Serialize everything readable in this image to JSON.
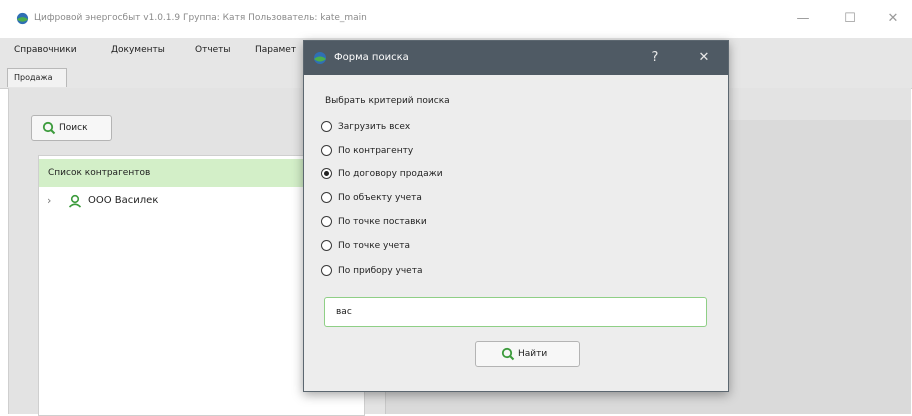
{
  "window": {
    "title": "Цифровой энергосбыт v1.0.1.9 Группа: Катя Пользователь: kate_main",
    "controls": {
      "minimize": "—",
      "maximize": "☐",
      "close": "✕"
    }
  },
  "menubar": {
    "items": [
      "Справочники",
      "Документы",
      "Отчеты",
      "Парамет"
    ]
  },
  "tabs": [
    {
      "label": "Продажа",
      "active": true
    }
  ],
  "left": {
    "search_button": "Поиск",
    "list_header": "Список контрагентов",
    "tree": [
      {
        "expander": "›",
        "icon": "person-icon",
        "label": "ООО Василек"
      }
    ]
  },
  "dialog": {
    "title": "Форма поиска",
    "help": "?",
    "close": "✕",
    "criteria_label": "Выбрать критерий поиска",
    "options": [
      {
        "label": "Загрузить всех",
        "checked": false
      },
      {
        "label": "По контрагенту",
        "checked": false
      },
      {
        "label": "По договору продажи",
        "checked": true
      },
      {
        "label": "По объекту учета",
        "checked": false
      },
      {
        "label": "По точке поставки",
        "checked": false
      },
      {
        "label": "По точке учета",
        "checked": false
      },
      {
        "label": "По прибору учета",
        "checked": false
      }
    ],
    "search_value": "вас",
    "find_button": "Найти"
  },
  "colors": {
    "accent_green": "#5aa84b",
    "header_green": "#d3efc8",
    "dialog_titlebar": "#4f5a64"
  }
}
